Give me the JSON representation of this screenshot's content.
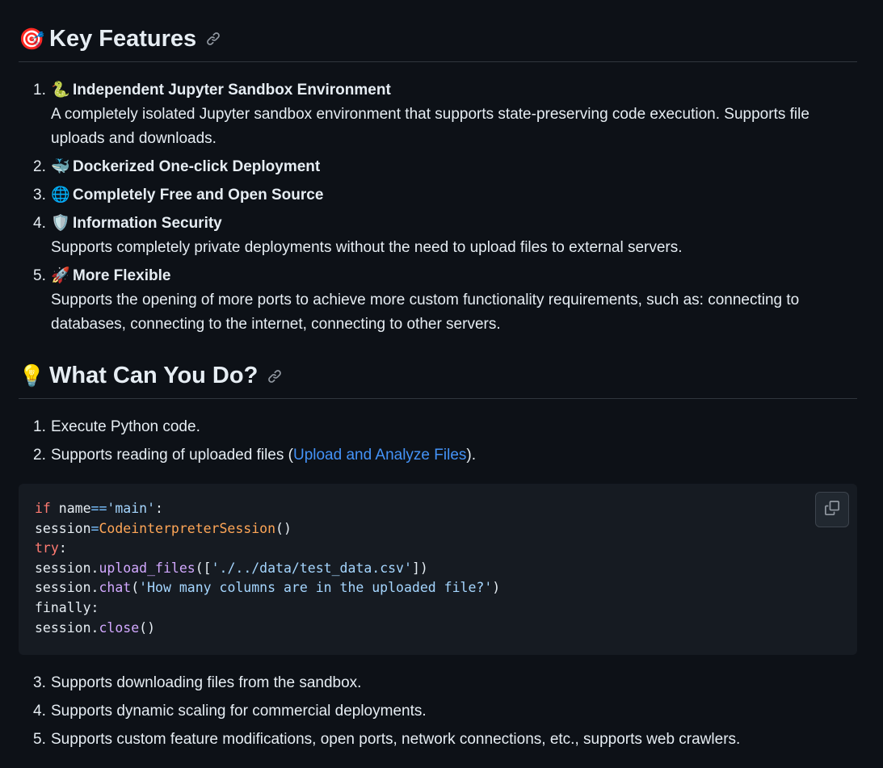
{
  "sections": {
    "key_features": {
      "emoji": "🎯",
      "title": "Key Features",
      "items": [
        {
          "num": "1.",
          "emoji": "🐍",
          "title": "Independent Jupyter Sandbox Environment",
          "desc": "A completely isolated Jupyter sandbox environment that supports state-preserving code execution. Supports file uploads and downloads."
        },
        {
          "num": "2.",
          "emoji": "🐳",
          "title": "Dockerized One-click Deployment",
          "desc": ""
        },
        {
          "num": "3.",
          "emoji": "🌐",
          "title": "Completely Free and Open Source",
          "desc": ""
        },
        {
          "num": "4.",
          "emoji": "🛡️",
          "title": "Information Security",
          "desc": "Supports completely private deployments without the need to upload files to external servers."
        },
        {
          "num": "5.",
          "emoji": "🚀",
          "title": "More Flexible",
          "desc": "Supports the opening of more ports to achieve more custom functionality requirements, such as: connecting to databases, connecting to the internet, connecting to other servers."
        }
      ]
    },
    "what_can_you_do": {
      "emoji": "💡",
      "title": "What Can You Do?",
      "items_before": [
        {
          "num": "1.",
          "text": "Execute Python code."
        },
        {
          "num": "2.",
          "text_before": "Supports reading of uploaded files (",
          "link": "Upload and Analyze Files",
          "text_after": ")."
        }
      ],
      "items_after": [
        {
          "num": "3.",
          "text": "Supports downloading files from the sandbox."
        },
        {
          "num": "4.",
          "text": "Supports dynamic scaling for commercial deployments."
        },
        {
          "num": "5.",
          "text": "Supports custom feature modifications, open ports, network connections, etc., supports web crawlers."
        }
      ]
    }
  },
  "code": {
    "lines": [
      "if name=='main':",
      "session=CodeinterpreterSession()",
      "try:",
      "session.upload_files(['./../data/test_data.csv'])",
      "session.chat('How many columns are in the uploaded file?')",
      "finally:",
      "session.close()"
    ]
  },
  "icons": {
    "anchor_link": "link-icon",
    "copy": "copy-icon"
  },
  "colors": {
    "background": "#0d1117",
    "code_background": "#161b22",
    "link": "#4493f8",
    "keyword": "#ff7b72",
    "string": "#a5d6ff",
    "function": "#d2a8ff",
    "class": "#ffa657"
  }
}
